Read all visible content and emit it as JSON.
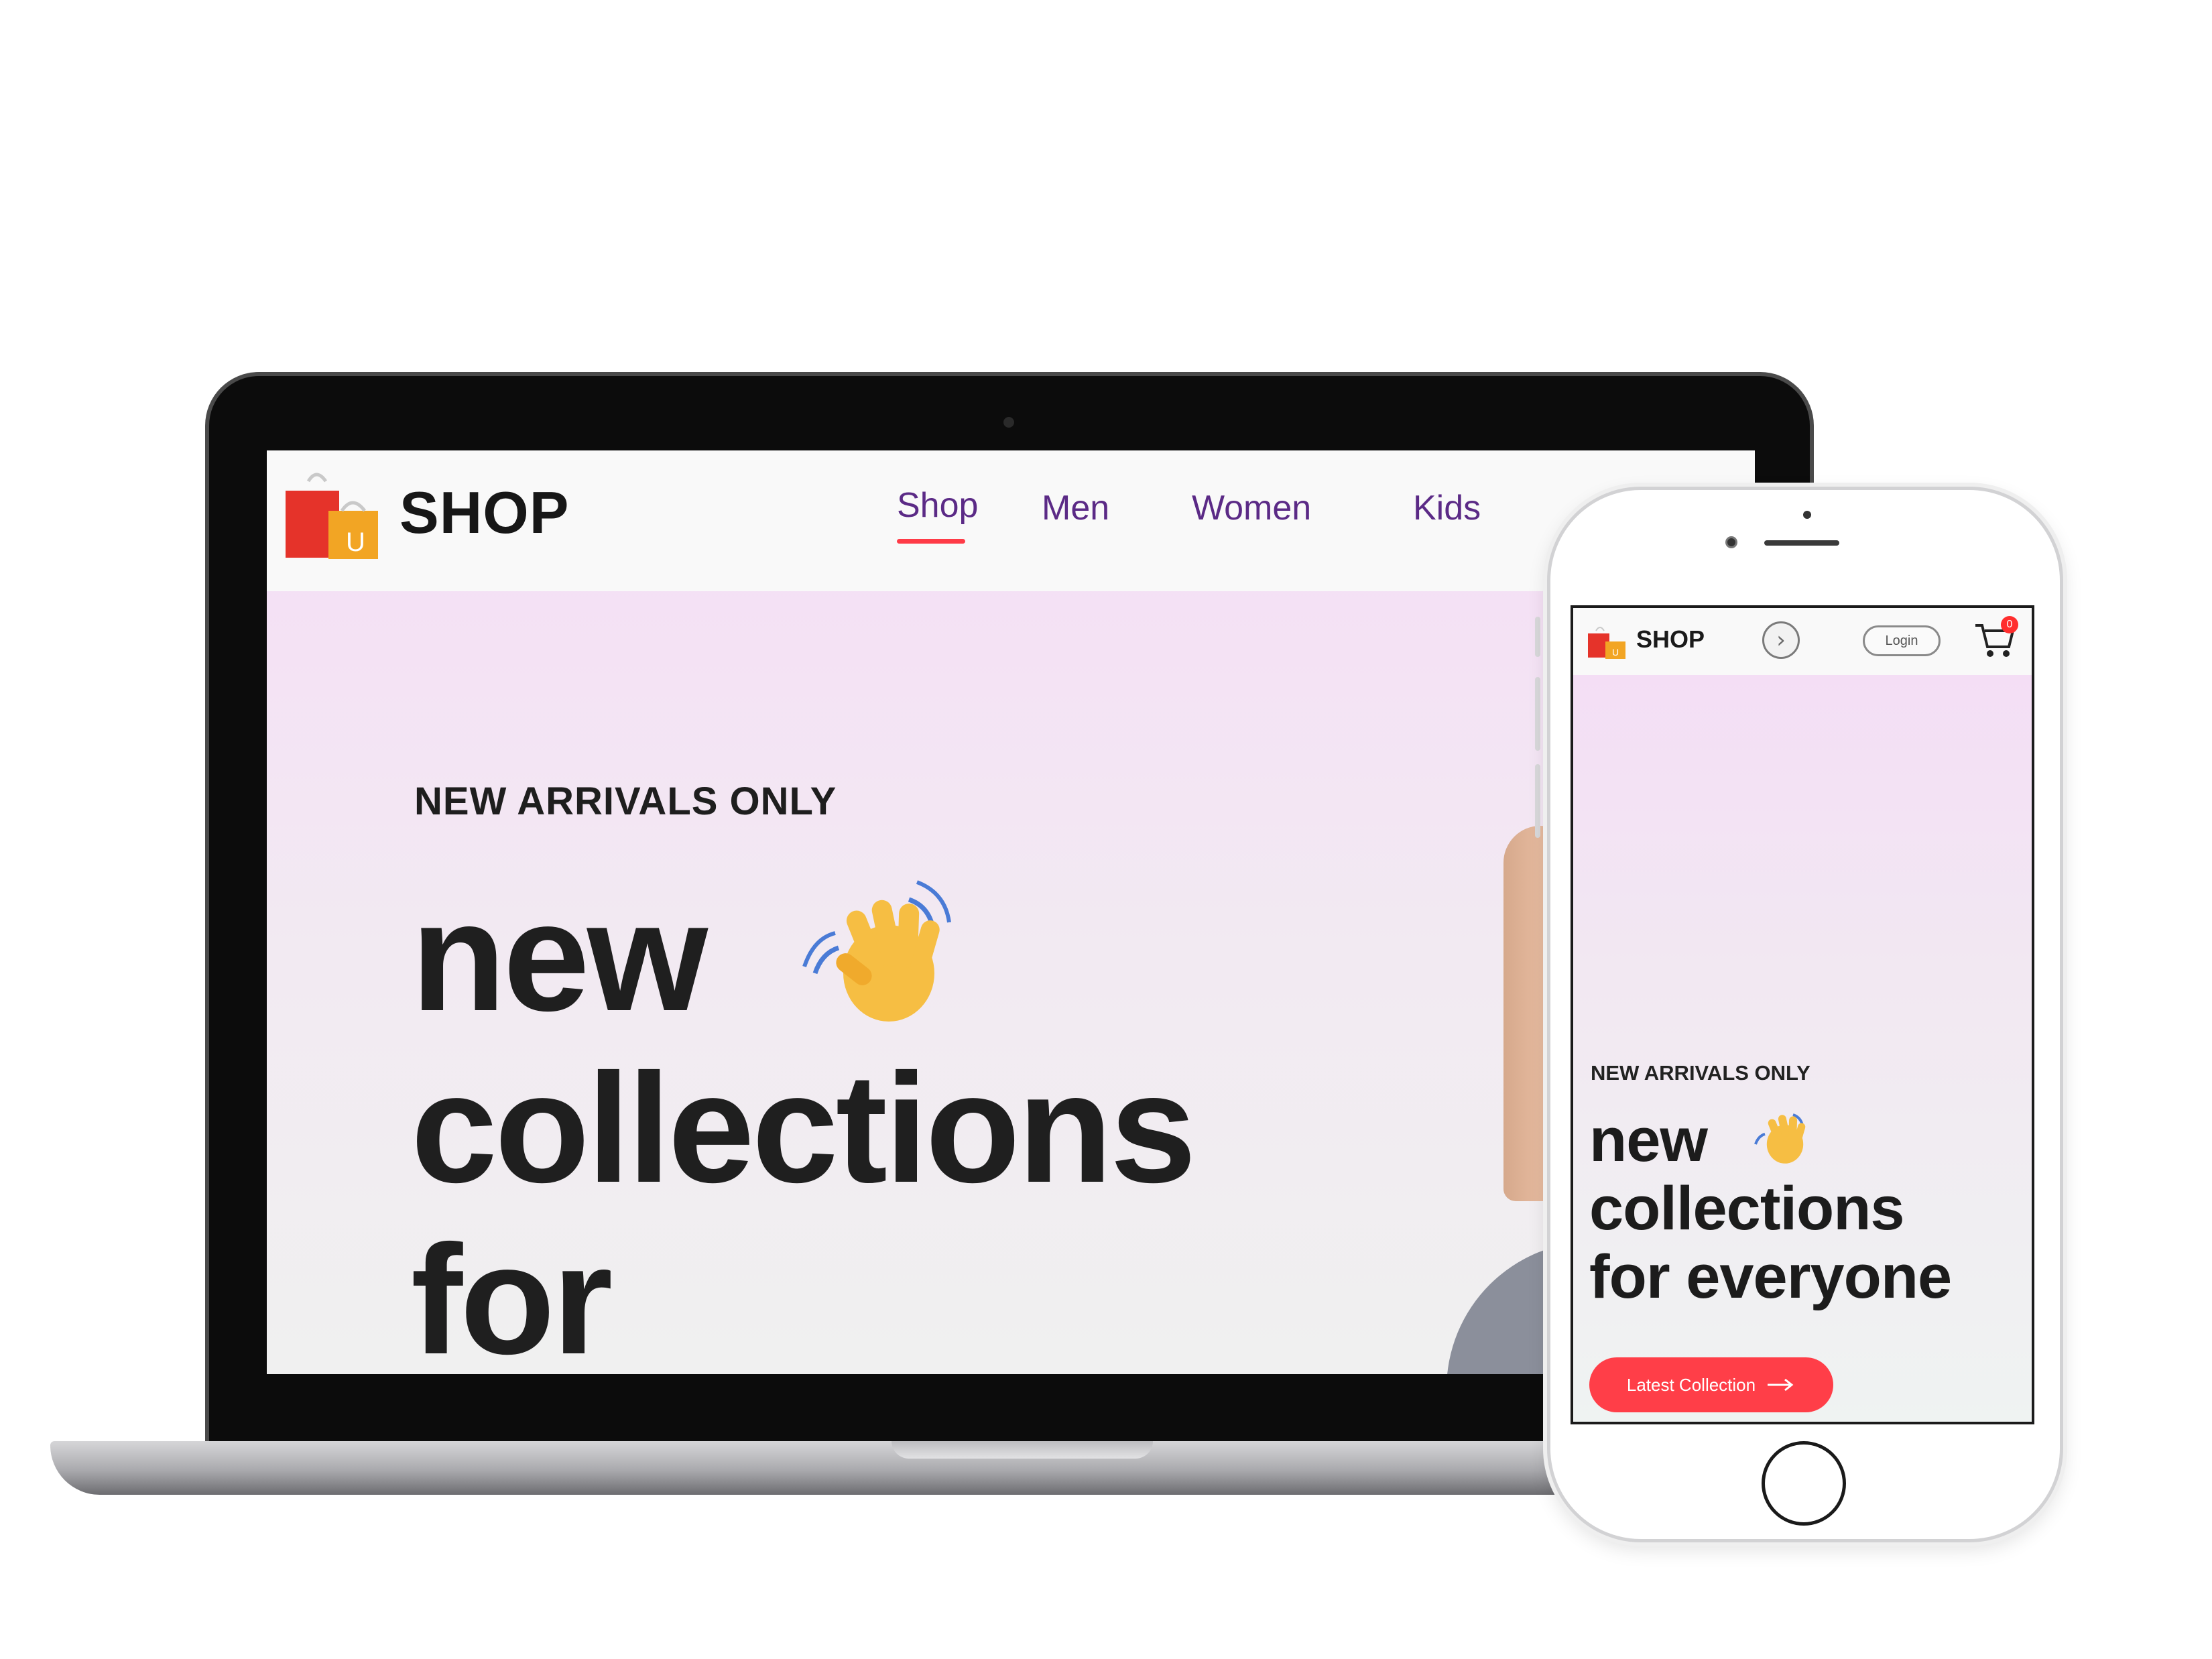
{
  "brand": "SHOP",
  "desktop": {
    "nav": {
      "items": [
        "Shop",
        "Men",
        "Women",
        "Kids"
      ],
      "active": "Shop"
    },
    "hero": {
      "kicker": "NEW ARRIVALS ONLY",
      "line1": "new",
      "line2": "collections",
      "line3": "for"
    }
  },
  "mobile": {
    "login_label": "Login",
    "cart_count": "0",
    "hero": {
      "kicker": "NEW ARRIVALS ONLY",
      "line1": "new",
      "line2": "collections",
      "line3": "for everyone",
      "cta_label": "Latest Collection"
    }
  },
  "colors": {
    "accent": "#ff3b47",
    "nav_text": "#5b2a86",
    "hero_gradient_top": "#f5ddf6"
  },
  "icons": [
    "shopping-bag-logo-icon",
    "waving-hand-icon",
    "chevron-right-icon",
    "cart-icon",
    "arrow-right-icon"
  ]
}
